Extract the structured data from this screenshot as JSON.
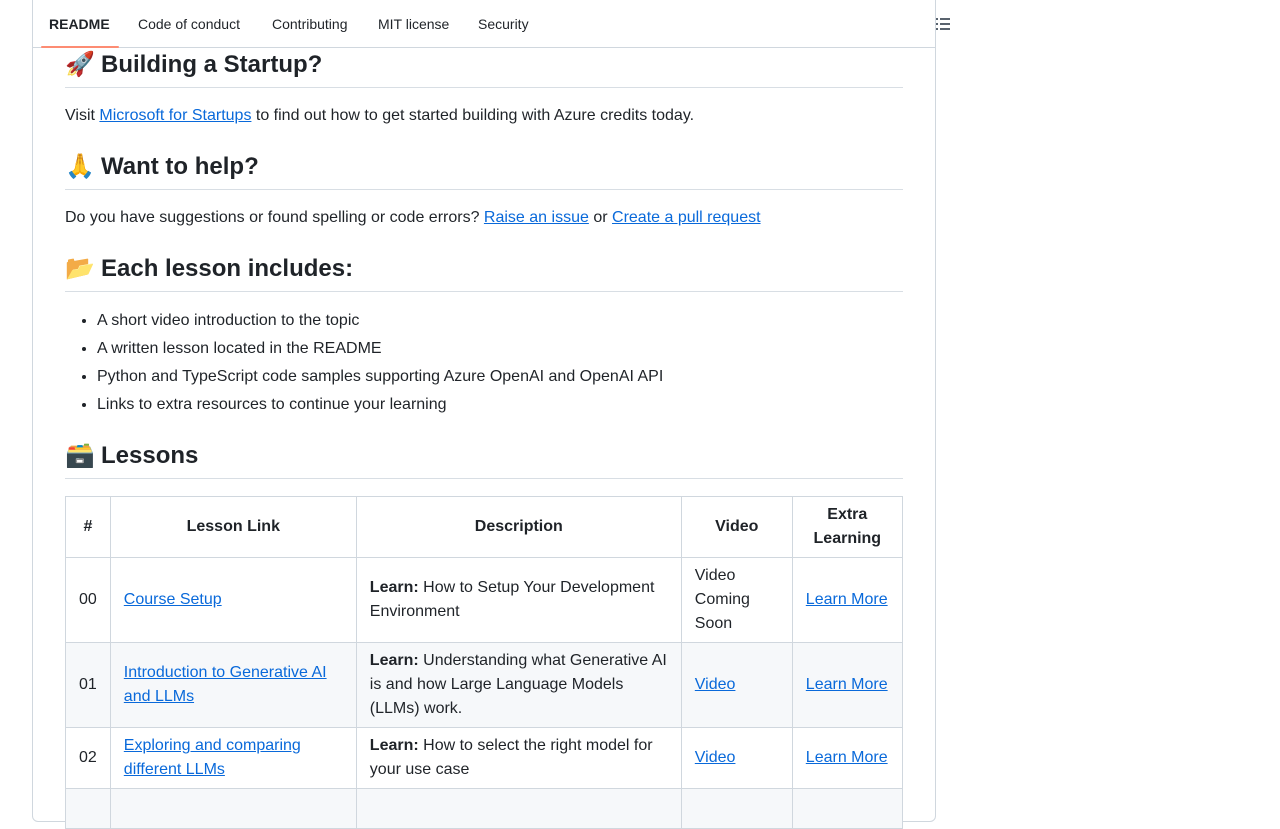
{
  "tabs": [
    {
      "label": "README",
      "active": true
    },
    {
      "label": "Code of conduct"
    },
    {
      "label": "Contributing"
    },
    {
      "label": "MIT license"
    },
    {
      "label": "Security"
    }
  ],
  "outline_icon": "list-unordered-icon",
  "colors": {
    "link": "#0969da",
    "tab_underline": "#fd8c73",
    "border": "#d0d7de"
  },
  "sections": {
    "startup": {
      "emoji": "🚀",
      "title": "Building a Startup?",
      "text_before": "Visit",
      "link": "Microsoft for Startups",
      "text_after": "to find out how to get started building with Azure credits today."
    },
    "help": {
      "emoji": "🙏",
      "title": "Want to help?",
      "text_before": "Do you have suggestions or found spelling or code errors?",
      "link1": "Raise an issue",
      "text_mid": "or",
      "link2": "Create a pull request"
    },
    "includes": {
      "emoji": "📂",
      "title": "Each lesson includes:",
      "items": [
        "A short video introduction to the topic",
        "A written lesson located in the README",
        "Python and TypeScript code samples supporting Azure OpenAI and OpenAI API",
        "Links to extra resources to continue your learning"
      ]
    },
    "lessons": {
      "emoji": "🗃️",
      "title": "Lessons"
    }
  },
  "table": {
    "headers": [
      "#",
      "Lesson Link",
      "Description",
      "Video",
      "Extra Learning"
    ],
    "rows": [
      {
        "num": "00",
        "lesson": "Course Setup",
        "learn": "Learn:",
        "desc": "How to Setup Your Development Environment",
        "video": "Video Coming Soon",
        "video_link": false,
        "extra": "Learn More"
      },
      {
        "num": "01",
        "lesson": "Introduction to Generative AI and LLMs",
        "learn": "Learn:",
        "desc": "Understanding what Generative AI is and how Large Language Models (LLMs) work.",
        "video": "Video",
        "video_link": true,
        "extra": "Learn More"
      },
      {
        "num": "02",
        "lesson": "Exploring and comparing different LLMs",
        "learn": "Learn:",
        "desc": "How to select the right model for your use case",
        "video": "Video",
        "video_link": true,
        "extra": "Learn More"
      },
      {
        "num": "",
        "lesson": "",
        "learn": "",
        "desc": "",
        "video": "",
        "video_link": false,
        "extra": ""
      }
    ]
  }
}
